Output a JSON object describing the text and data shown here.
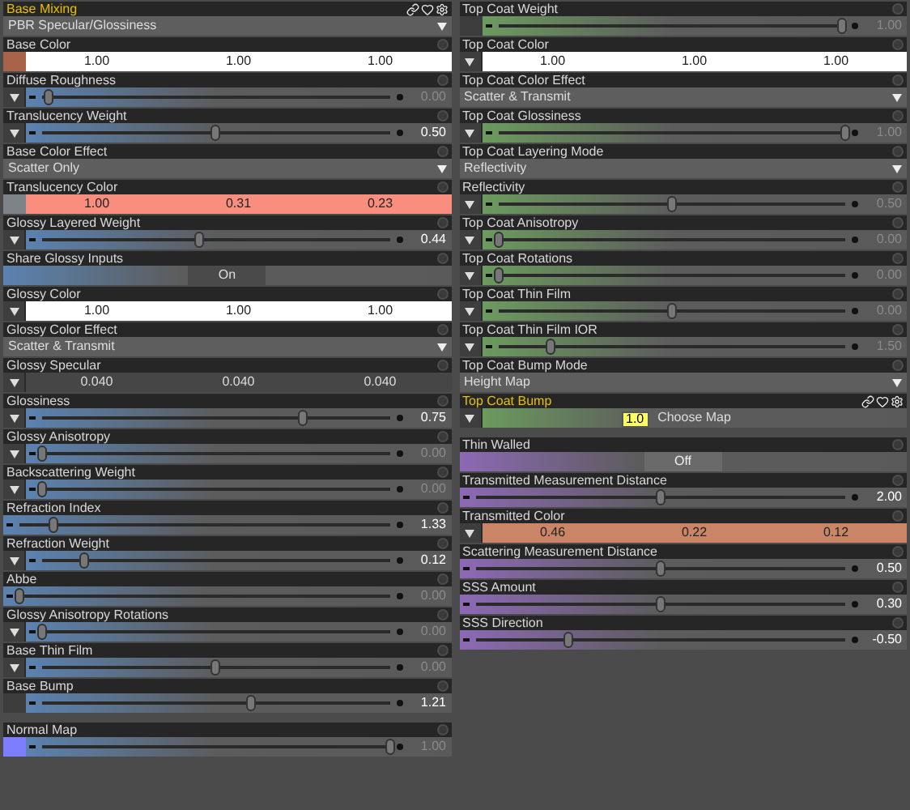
{
  "columns": [
    {
      "sections": [
        {
          "color": "#5b82b0",
          "properties": [
            {
              "label": "Base Mixing",
              "kind": "dropdown",
              "selected": true,
              "value": "PBR Specular/Glossiness"
            },
            {
              "label": "Base Color",
              "kind": "color",
              "selected": false,
              "map": {
                "kind": "texture",
                "color": "#a8644a"
              },
              "color": "#ffffff",
              "values": [
                "1.00",
                "1.00",
                "1.00"
              ]
            },
            {
              "label": "Diffuse Roughness",
              "kind": "slider",
              "selected": false,
              "map": {
                "kind": "button"
              },
              "level": 0.02,
              "value": "0.00",
              "dimmed": true
            },
            {
              "label": "Translucency Weight",
              "kind": "slider",
              "selected": false,
              "map": {
                "kind": "button"
              },
              "level": 0.5,
              "value": "0.50",
              "dimmed": false
            },
            {
              "label": "Base Color Effect",
              "kind": "dropdown",
              "selected": false,
              "value": "Scatter Only"
            },
            {
              "label": "Translucency Color",
              "kind": "color",
              "selected": false,
              "map": {
                "kind": "texture",
                "color": "#7d8489"
              },
              "color": "#f98e7e",
              "values": [
                "1.00",
                "0.31",
                "0.23"
              ]
            },
            {
              "label": "Glossy Layered Weight",
              "kind": "slider",
              "selected": false,
              "map": {
                "kind": "button"
              },
              "level": 0.45,
              "value": "0.44",
              "dimmed": false
            },
            {
              "label": "Share Glossy Inputs",
              "kind": "toggle",
              "selected": false,
              "on": true,
              "state_text": "On"
            },
            {
              "label": "Glossy Color",
              "kind": "color",
              "selected": false,
              "map": {
                "kind": "button"
              },
              "color": "#ffffff",
              "values": [
                "1.00",
                "1.00",
                "1.00"
              ]
            },
            {
              "label": "Glossy Color Effect",
              "kind": "dropdown",
              "selected": false,
              "value": "Scatter & Transmit"
            },
            {
              "label": "Glossy Specular",
              "kind": "color",
              "selected": false,
              "map": {
                "kind": "button"
              },
              "color": "#464646",
              "values": [
                "0.040",
                "0.040",
                "0.040"
              ]
            },
            {
              "label": "Glossiness",
              "kind": "slider",
              "selected": false,
              "map": {
                "kind": "button"
              },
              "level": 0.75,
              "value": "0.75",
              "dimmed": false
            },
            {
              "label": "Glossy Anisotropy",
              "kind": "slider",
              "selected": false,
              "map": {
                "kind": "button"
              },
              "level": 0.0,
              "value": "0.00",
              "dimmed": true
            },
            {
              "label": "Backscattering Weight",
              "kind": "slider",
              "selected": false,
              "map": {
                "kind": "button"
              },
              "level": 0.0,
              "value": "0.00",
              "dimmed": true
            },
            {
              "label": "Refraction Index",
              "kind": "slider",
              "selected": false,
              "level": 0.09,
              "value": "1.33",
              "dimmed": false
            },
            {
              "label": "Refraction Weight",
              "kind": "slider",
              "selected": false,
              "map": {
                "kind": "button"
              },
              "level": 0.12,
              "value": "0.12",
              "dimmed": false
            },
            {
              "label": "Abbe",
              "kind": "slider",
              "selected": false,
              "level": 0.0,
              "value": "0.00",
              "dimmed": true
            },
            {
              "label": "Glossy Anisotropy Rotations",
              "kind": "slider",
              "selected": false,
              "map": {
                "kind": "button"
              },
              "level": 0.0,
              "value": "0.00",
              "dimmed": true
            },
            {
              "label": "Base Thin Film",
              "kind": "slider",
              "selected": false,
              "map": {
                "kind": "button"
              },
              "level": 0.5,
              "value": "0.00",
              "dimmed": true
            },
            {
              "label": "Base Bump",
              "kind": "slider",
              "selected": false,
              "map": {
                "kind": "texture",
                "color": "#3c3c3c"
              },
              "level": 0.6,
              "value": "1.21",
              "dimmed": false
            }
          ]
        },
        {
          "color": "#5b82b0",
          "properties": [
            {
              "label": "Normal Map",
              "kind": "slider",
              "selected": false,
              "map": {
                "kind": "texture",
                "color": "#7d7dff"
              },
              "level": 1.0,
              "value": "1.00",
              "dimmed": true
            }
          ]
        }
      ]
    },
    {
      "sections": [
        {
          "color": "#6c9a5e",
          "properties": [
            {
              "label": "Top Coat Weight",
              "kind": "slider",
              "selected": false,
              "map": {
                "kind": "texture",
                "color": "#3c3c3c"
              },
              "level": 0.99,
              "value": "1.00",
              "dimmed": true
            },
            {
              "label": "Top Coat Color",
              "kind": "color",
              "selected": false,
              "map": {
                "kind": "button"
              },
              "color": "#ffffff",
              "values": [
                "1.00",
                "1.00",
                "1.00"
              ]
            },
            {
              "label": "Top Coat Color Effect",
              "kind": "dropdown",
              "selected": false,
              "value": "Scatter & Transmit"
            },
            {
              "label": "Top Coat Glossiness",
              "kind": "slider",
              "selected": false,
              "map": {
                "kind": "button"
              },
              "level": 1.0,
              "value": "1.00",
              "dimmed": true
            },
            {
              "label": "Top Coat Layering Mode",
              "kind": "dropdown",
              "selected": false,
              "value": "Reflectivity"
            },
            {
              "label": "Reflectivity",
              "kind": "slider",
              "selected": false,
              "map": {
                "kind": "button"
              },
              "level": 0.5,
              "value": "0.50",
              "dimmed": true
            },
            {
              "label": "Top Coat Anisotropy",
              "kind": "slider",
              "selected": false,
              "map": {
                "kind": "button"
              },
              "level": 0.0,
              "value": "0.00",
              "dimmed": true
            },
            {
              "label": "Top Coat Rotations",
              "kind": "slider",
              "selected": false,
              "map": {
                "kind": "button"
              },
              "level": 0.0,
              "value": "0.00",
              "dimmed": true
            },
            {
              "label": "Top Coat Thin Film",
              "kind": "slider",
              "selected": false,
              "map": {
                "kind": "button"
              },
              "level": 0.5,
              "value": "0.00",
              "dimmed": true
            },
            {
              "label": "Top Coat Thin Film IOR",
              "kind": "slider",
              "selected": false,
              "map": {
                "kind": "button"
              },
              "level": 0.15,
              "value": "1.50",
              "dimmed": true
            },
            {
              "label": "Top Coat Bump Mode",
              "kind": "dropdown",
              "selected": false,
              "value": "Height Map"
            },
            {
              "label": "Top Coat Bump",
              "kind": "map",
              "selected": true,
              "map": {
                "kind": "button"
              },
              "value": "Choose Map",
              "tooltip": "1.0"
            }
          ]
        },
        {
          "color": "#8c69b5",
          "properties": [
            {
              "label": "Thin Walled",
              "kind": "toggle",
              "selected": false,
              "on": false,
              "state_text": "Off"
            },
            {
              "label": "Transmitted Measurement Distance",
              "kind": "slider",
              "selected": false,
              "level": 0.5,
              "value": "2.00",
              "dimmed": false
            },
            {
              "label": "Transmitted Color",
              "kind": "color",
              "selected": false,
              "map": {
                "kind": "button"
              },
              "color": "#c98566",
              "values": [
                "0.46",
                "0.22",
                "0.12"
              ]
            },
            {
              "label": "Scattering Measurement Distance",
              "kind": "slider",
              "selected": false,
              "level": 0.5,
              "value": "0.50",
              "dimmed": false
            },
            {
              "label": "SSS Amount",
              "kind": "slider",
              "selected": false,
              "level": 0.5,
              "value": "0.30",
              "dimmed": false
            },
            {
              "label": "SSS Direction",
              "kind": "slider",
              "selected": false,
              "level": 0.25,
              "value": "-0.50",
              "dimmed": false
            }
          ]
        }
      ]
    }
  ]
}
